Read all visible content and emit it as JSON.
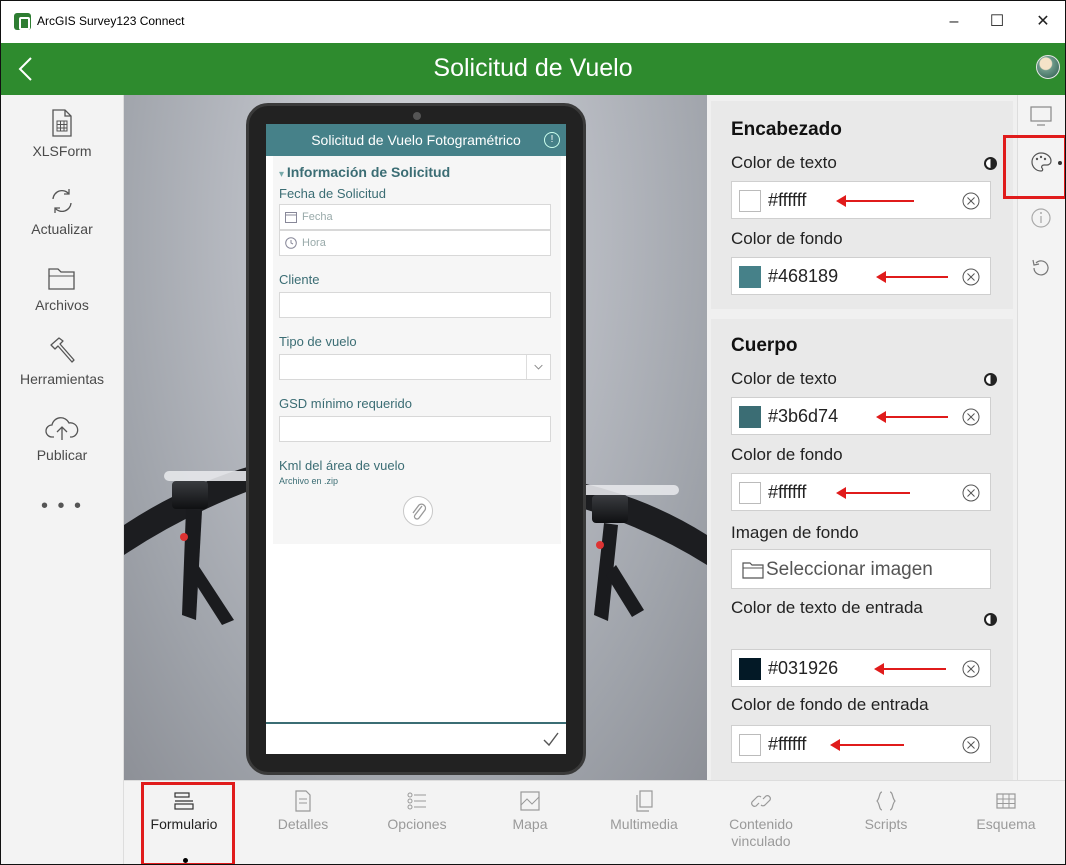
{
  "window": {
    "title": "ArcGIS Survey123 Connect",
    "minimize": "–",
    "maximize": "☐",
    "close": "✕"
  },
  "header": {
    "title": "Solicitud de Vuelo"
  },
  "sidebar": {
    "items": [
      {
        "label": "XLSForm",
        "icon": "xlsform-icon"
      },
      {
        "label": "Actualizar",
        "icon": "refresh-icon"
      },
      {
        "label": "Archivos",
        "icon": "folder-icon"
      },
      {
        "label": "Herramientas",
        "icon": "hammer-icon"
      },
      {
        "label": "Publicar",
        "icon": "cloud-upload-icon"
      }
    ],
    "more": "• • •"
  },
  "preview": {
    "form_title": "Solicitud de Vuelo Fotogramétrico",
    "group_title": "Información de Solicitud",
    "fields": {
      "fecha_label": "Fecha de Solicitud",
      "fecha_placeholder": "Fecha",
      "hora_placeholder": "Hora",
      "cliente_label": "Cliente",
      "tipo_label": "Tipo de vuelo",
      "gsd_label": "GSD mínimo requerido",
      "kml_label": "Kml del área de vuelo",
      "kml_hint": "Archivo en .zip"
    }
  },
  "panel": {
    "encabezado": {
      "title": "Encabezado",
      "text_color_label": "Color de texto",
      "text_color": "#ffffff",
      "bg_color_label": "Color de fondo",
      "bg_color": "#468189"
    },
    "cuerpo": {
      "title": "Cuerpo",
      "text_color_label": "Color de texto",
      "text_color": "#3b6d74",
      "bg_color_label": "Color de fondo",
      "bg_color": "#ffffff",
      "bg_image_label": "Imagen de fondo",
      "bg_image_button": "Seleccionar imagen",
      "input_text_color_label": "Color de texto de entrada",
      "input_text_color": "#031926",
      "input_bg_color_label": "Color de fondo de entrada",
      "input_bg_color": "#ffffff"
    }
  },
  "tools": [
    "monitor-icon",
    "palette-icon",
    "info-icon",
    "history-icon"
  ],
  "bottom_tabs": [
    {
      "label": "Formulario",
      "active": true
    },
    {
      "label": "Detalles",
      "active": false
    },
    {
      "label": "Opciones",
      "active": false
    },
    {
      "label": "Mapa",
      "active": false
    },
    {
      "label": "Multimedia",
      "active": false
    },
    {
      "label": "Contenido vinculado",
      "active": false
    },
    {
      "label": "Scripts",
      "active": false
    },
    {
      "label": "Esquema",
      "active": false
    }
  ],
  "colors": {
    "app_header": "#2e8b2e",
    "highlight": "#e01b1b",
    "form_header": "#468189",
    "form_text": "#3b6d74"
  }
}
